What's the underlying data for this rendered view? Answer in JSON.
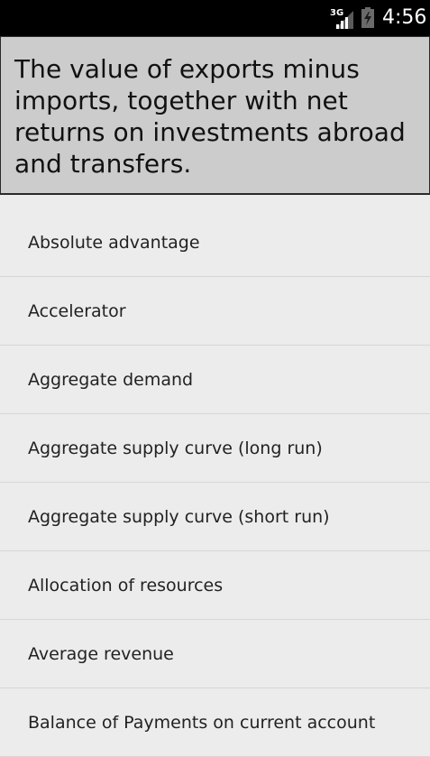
{
  "status_bar": {
    "network_type": "3G",
    "time": "4:56",
    "network_icon": "signal-3g-icon",
    "battery_icon": "battery-charging-icon"
  },
  "definition": {
    "text": "The value of exports minus imports, together with net returns on investments abroad and transfers."
  },
  "terms": [
    "Absolute advantage",
    "Accelerator",
    "Aggregate demand",
    "Aggregate supply curve (long run)",
    "Aggregate supply curve (short run)",
    "Allocation of resources",
    "Average revenue",
    "Balance of Payments on current account"
  ],
  "colors": {
    "status_bar_bg": "#000000",
    "definition_bg": "#cccccc",
    "list_bg": "#ececec",
    "divider": "#d6d6d6"
  }
}
